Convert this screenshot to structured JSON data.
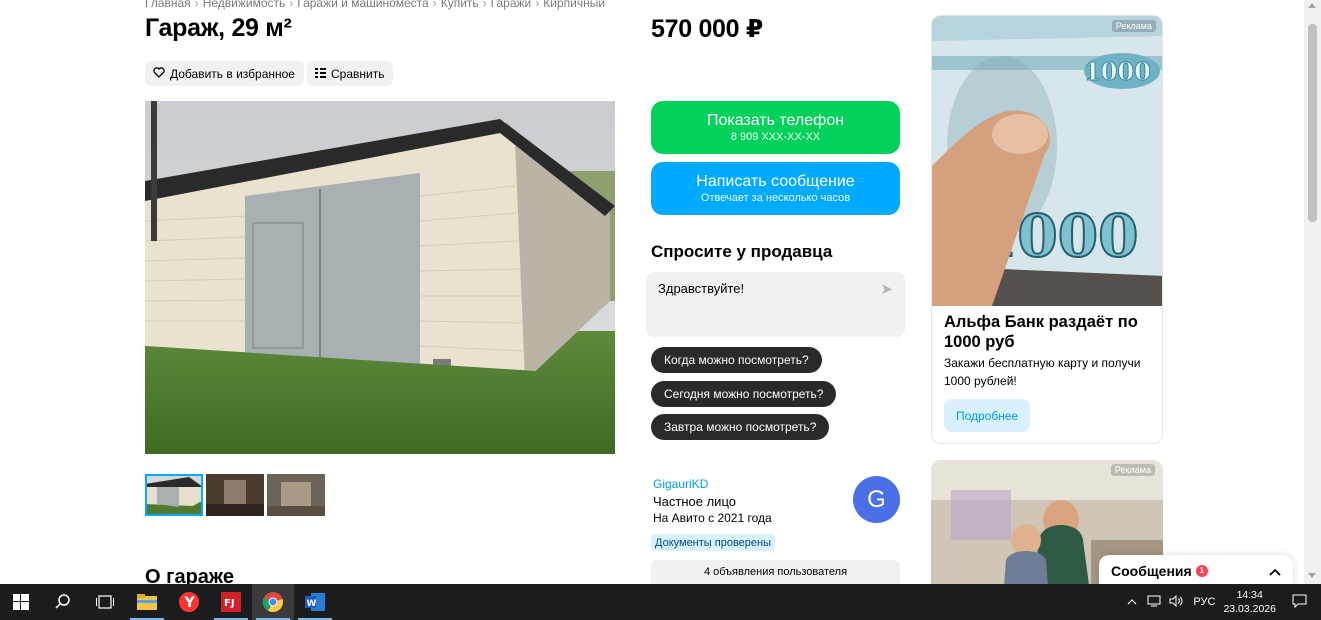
{
  "breadcrumb": [
    "Главная",
    "Недвижимость",
    "Гаражи и машиноместа",
    "Купить",
    "Гаражи",
    "Кирпичный"
  ],
  "listing": {
    "title": "Гараж, 29 м²",
    "price": "570 000 ₽",
    "favorite_label": "Добавить в избранное",
    "compare_label": "Сравнить",
    "about_heading": "О гараже"
  },
  "contact": {
    "show_phone_label": "Показать телефон",
    "phone_masked": "8 909 XXX-XX-XX",
    "write_label": "Написать сообщение",
    "write_sub": "Отвечает за несколько часов"
  },
  "ask": {
    "heading": "Спросите у продавца",
    "message": "Здравствуйте!",
    "quick": [
      "Когда можно посмотреть?",
      "Сегодня можно посмотреть?",
      "Завтра можно посмотреть?"
    ]
  },
  "seller": {
    "name": "GigauriKD",
    "type": "Частное лицо",
    "since": "На Авито с 2021 года",
    "badge": "Документы проверены",
    "avatar_letter": "G",
    "ads_count_label": "4 объявления пользователя"
  },
  "ad": {
    "label": "Реклама",
    "title": "Альфа Банк раздаёт по 1000 руб",
    "text": "Закажи бесплатную карту и получи 1000 рублей!",
    "button": "Подробнее",
    "banknote": "1000"
  },
  "ad2": {
    "label": "Реклама"
  },
  "messages": {
    "label": "Сообщения",
    "unread": "1"
  },
  "taskbar": {
    "lang": "РУС",
    "time": "14:34",
    "date": "23.03.2026",
    "apps": [
      "windows-start",
      "search",
      "task-view",
      "file-explorer",
      "yandex-browser",
      "fj-app",
      "chrome",
      "word"
    ]
  },
  "colors": {
    "green": "#02d15c",
    "blue": "#00aaff",
    "link": "#0099f7",
    "avatar": "#4a6fe6"
  }
}
